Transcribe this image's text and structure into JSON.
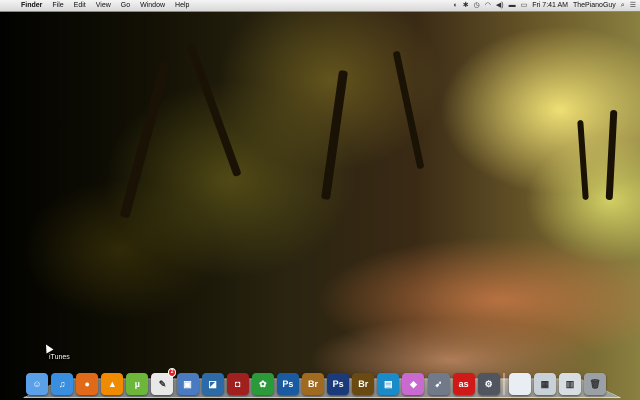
{
  "menubar": {
    "apple": "",
    "app_name": "Finder",
    "menus": [
      "File",
      "Edit",
      "View",
      "Go",
      "Window",
      "Help"
    ],
    "status": {
      "clock": "Fri 7:41 AM",
      "user": "ThePianoGuy"
    }
  },
  "desktop": {
    "hover_label": "iTunes"
  },
  "dock": {
    "icons": [
      {
        "name": "finder",
        "color": "#5aa0e8",
        "glyph": "☺"
      },
      {
        "name": "itunes",
        "color": "#3a8ee0",
        "glyph": "♫"
      },
      {
        "name": "firefox",
        "color": "#e06a1a",
        "glyph": "●"
      },
      {
        "name": "vlc",
        "color": "#f08a00",
        "glyph": "▲"
      },
      {
        "name": "utorrent",
        "color": "#6cb63a",
        "glyph": "µ"
      },
      {
        "name": "textedit",
        "color": "#e8e8e8",
        "glyph": "✎"
      },
      {
        "name": "preview",
        "color": "#4a7ac0",
        "glyph": "▣"
      },
      {
        "name": "iphoto",
        "color": "#2c6aa8",
        "glyph": "◪"
      },
      {
        "name": "photo-booth",
        "color": "#a02020",
        "glyph": "◘"
      },
      {
        "name": "app-green",
        "color": "#2a9a3a",
        "glyph": "✿"
      },
      {
        "name": "photoshop",
        "color": "#1a5aa0",
        "glyph": "Ps"
      },
      {
        "name": "bridge",
        "color": "#a06a20",
        "glyph": "Br"
      },
      {
        "name": "photoshop-2",
        "color": "#1a3a7a",
        "glyph": "Ps"
      },
      {
        "name": "bridge-2",
        "color": "#6a4a10",
        "glyph": "Br"
      },
      {
        "name": "app-blue",
        "color": "#1a8ac8",
        "glyph": "▤"
      },
      {
        "name": "app-colorful",
        "color": "#c86ad0",
        "glyph": "◆"
      },
      {
        "name": "rocket",
        "color": "#707a88",
        "glyph": "➹"
      },
      {
        "name": "lastfm",
        "color": "#d01a1a",
        "glyph": "as"
      },
      {
        "name": "app-gray",
        "color": "#505560",
        "glyph": "⚙"
      },
      {
        "name": "folder",
        "color": "#e8eef4",
        "glyph": ""
      },
      {
        "name": "downloads",
        "color": "#c8d0d8",
        "glyph": "▦"
      },
      {
        "name": "documents",
        "color": "#d8dde2",
        "glyph": "▥"
      },
      {
        "name": "trash",
        "color": "#9aa0a6",
        "glyph": "🗑"
      }
    ],
    "badge": "2"
  }
}
